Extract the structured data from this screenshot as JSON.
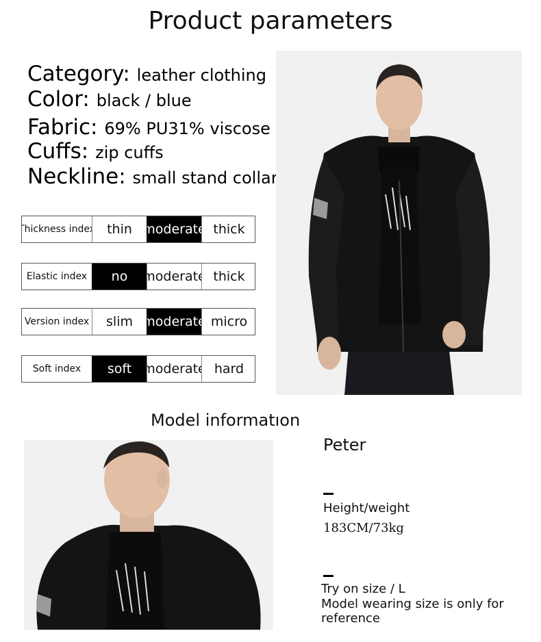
{
  "title": "Product parameters",
  "specs": [
    {
      "label": "Category:",
      "value": "leather clothing"
    },
    {
      "label": "Color:",
      "value": "black / blue"
    },
    {
      "label": "Fabric:",
      "value": "69% PU31% viscose"
    },
    {
      "label": "Cuffs:",
      "value": "zip cuffs"
    },
    {
      "label": "Neckline:",
      "value": "small stand collar"
    }
  ],
  "indexes": [
    {
      "label": "Thickness index",
      "options": [
        "thin",
        "moderate",
        "thick"
      ],
      "selected": "moderate"
    },
    {
      "label": "Elastic index",
      "options": [
        "no",
        "moderate",
        "thick"
      ],
      "selected": "no"
    },
    {
      "label": "Version index",
      "options": [
        "slim",
        "moderate",
        "micro"
      ],
      "selected": "moderate"
    },
    {
      "label": "Soft index",
      "options": [
        "soft",
        "moderate",
        "hard"
      ],
      "selected": "soft"
    }
  ],
  "model_section_title": "Model informatıon",
  "model": {
    "name": "Peter",
    "height_weight_label": "Height/weight",
    "height_weight_value": "183CM/73kg",
    "try_on_line1": "Try on size / L",
    "try_on_line2": "Model wearing size is only for",
    "try_on_line3": "reference"
  },
  "colors": {
    "selected_bg": "#000000",
    "selected_fg": "#ffffff",
    "jacket": "#141414",
    "photo_bg": "#f1f1f1"
  }
}
